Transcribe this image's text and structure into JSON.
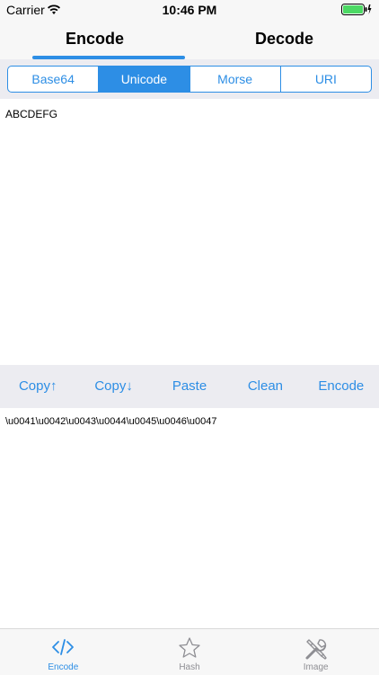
{
  "status": {
    "carrier": "Carrier",
    "time": "10:46 PM"
  },
  "top_tabs": [
    {
      "label": "Encode",
      "active": true
    },
    {
      "label": "Decode",
      "active": false
    }
  ],
  "segments": [
    {
      "label": "Base64",
      "selected": false
    },
    {
      "label": "Unicode",
      "selected": true
    },
    {
      "label": "Morse",
      "selected": false
    },
    {
      "label": "URI",
      "selected": false
    }
  ],
  "input": {
    "value": "ABCDEFG"
  },
  "actions": [
    "Copy↑",
    "Copy↓",
    "Paste",
    "Clean",
    "Encode"
  ],
  "output": {
    "value": "\\u0041\\u0042\\u0043\\u0044\\u0045\\u0046\\u0047"
  },
  "tab_bar": [
    {
      "label": "Encode",
      "icon": "code-icon",
      "active": true
    },
    {
      "label": "Hash",
      "icon": "star-icon",
      "active": false
    },
    {
      "label": "Image",
      "icon": "tools-icon",
      "active": false
    }
  ],
  "colors": {
    "accent": "#2d8ee5",
    "inactive": "#8e8e93",
    "battery": "#4cd964"
  }
}
